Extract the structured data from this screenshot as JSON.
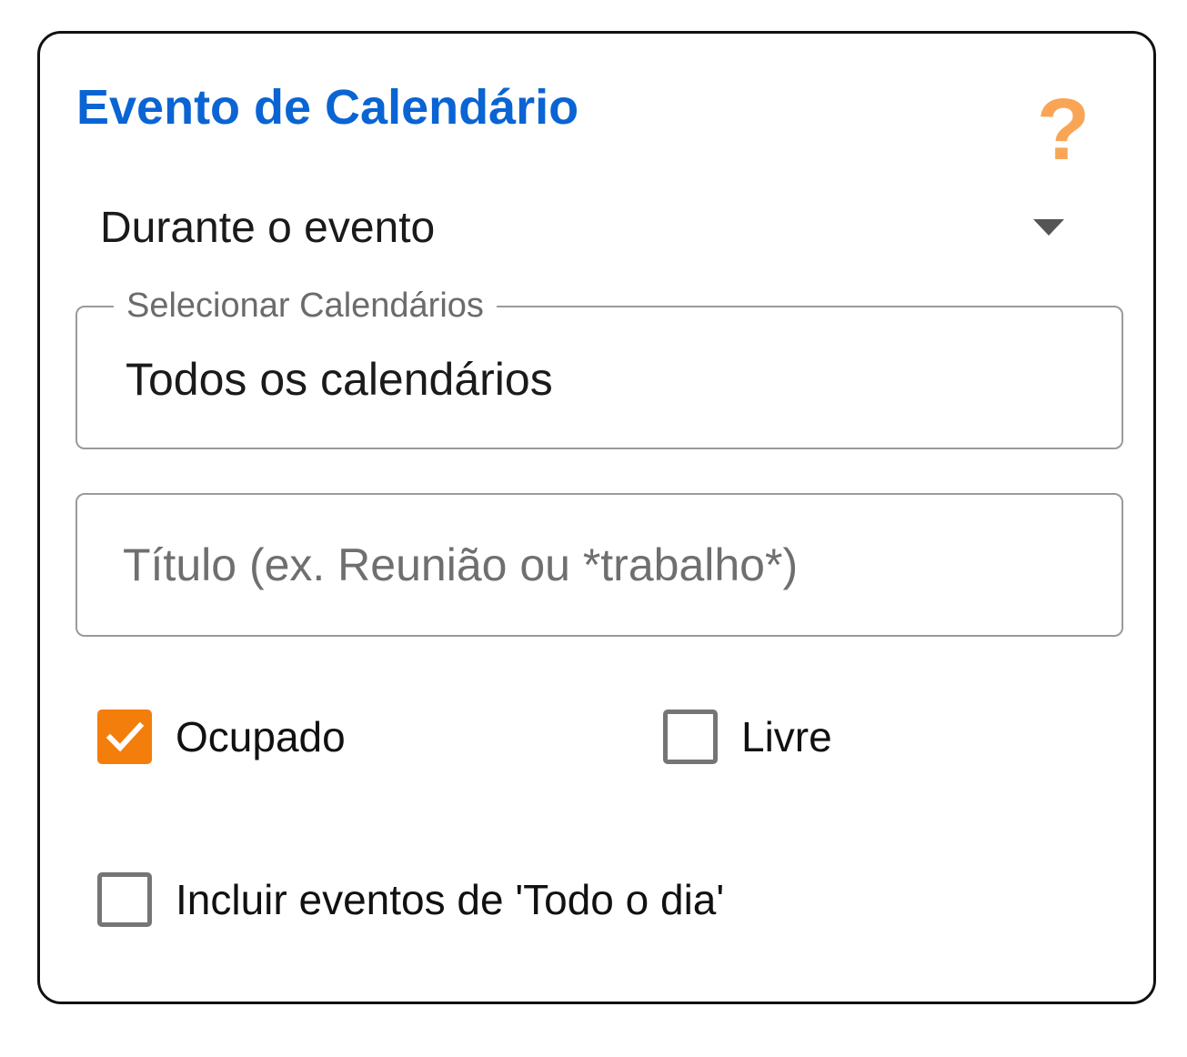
{
  "header": {
    "title": "Evento de Calendário",
    "help_icon": "question-mark-icon",
    "help_glyph": "?"
  },
  "event_mode": {
    "selected": "Durante o evento"
  },
  "calendars": {
    "label": "Selecionar Calendários",
    "value": "Todos os calendários"
  },
  "title_filter": {
    "value": "",
    "placeholder": "Título (ex. Reunião ou *trabalho*)"
  },
  "options": {
    "busy": {
      "label": "Ocupado",
      "checked": true
    },
    "free": {
      "label": "Livre",
      "checked": false
    },
    "all_day": {
      "label": "Incluir eventos de 'Todo o dia'",
      "checked": false
    }
  },
  "colors": {
    "title": "#0a64d3",
    "accent": "#f47e0b",
    "help": "#f9a555"
  }
}
